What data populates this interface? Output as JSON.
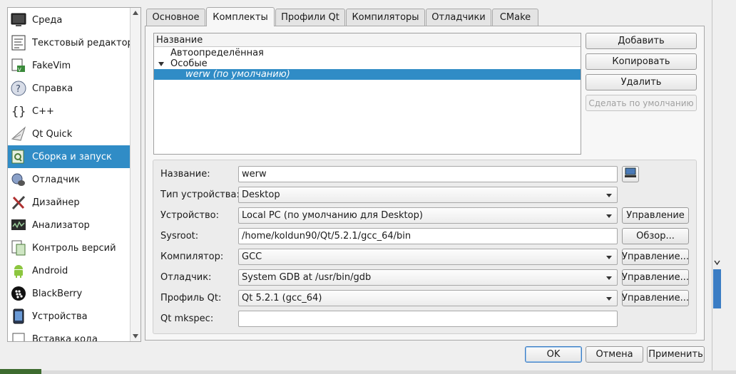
{
  "sidebar": {
    "items": [
      {
        "label": "Среда",
        "icon": "monitor-icon",
        "selected": false
      },
      {
        "label": "Текстовый редактор",
        "icon": "text-editor-icon",
        "selected": false
      },
      {
        "label": "FakeVim",
        "icon": "fakevim-icon",
        "selected": false
      },
      {
        "label": "Справка",
        "icon": "help-icon",
        "selected": false
      },
      {
        "label": "C++",
        "icon": "braces-icon",
        "selected": false
      },
      {
        "label": "Qt Quick",
        "icon": "qtquick-icon",
        "selected": false
      },
      {
        "label": "Сборка и запуск",
        "icon": "build-run-icon",
        "selected": true
      },
      {
        "label": "Отладчик",
        "icon": "debugger-icon",
        "selected": false
      },
      {
        "label": "Дизайнер",
        "icon": "designer-icon",
        "selected": false
      },
      {
        "label": "Анализатор",
        "icon": "analyzer-icon",
        "selected": false
      },
      {
        "label": "Контроль версий",
        "icon": "version-control-icon",
        "selected": false
      },
      {
        "label": "Android",
        "icon": "android-icon",
        "selected": false
      },
      {
        "label": "BlackBerry",
        "icon": "blackberry-icon",
        "selected": false
      },
      {
        "label": "Устройства",
        "icon": "devices-icon",
        "selected": false
      },
      {
        "label": "Вставка кода",
        "icon": "code-paste-icon",
        "selected": false
      }
    ]
  },
  "tabs": [
    {
      "label": "Основное",
      "active": false
    },
    {
      "label": "Комплекты",
      "active": true
    },
    {
      "label": "Профили Qt",
      "active": false
    },
    {
      "label": "Компиляторы",
      "active": false
    },
    {
      "label": "Отладчики",
      "active": false
    },
    {
      "label": "CMake",
      "active": false
    }
  ],
  "kits": {
    "header": "Название",
    "auto_group": "Автоопределённая",
    "manual_group": "Особые",
    "selected_kit": "werw (по умолчанию)"
  },
  "kit_buttons": {
    "add": "Добавить",
    "copy": "Копировать",
    "remove": "Удалить",
    "make_default": "Сделать по умолчанию"
  },
  "form": {
    "name_label": "Название:",
    "name_value": "werw",
    "device_type_label": "Тип устройства:",
    "device_type_value": "Desktop",
    "device_label": "Устройство:",
    "device_value": "Local PC (по умолчанию для Desktop)",
    "device_manage": "Управление",
    "sysroot_label": "Sysroot:",
    "sysroot_value": "/home/koldun90/Qt/5.2.1/gcc_64/bin",
    "sysroot_browse": "Обзор...",
    "compiler_label": "Компилятор:",
    "compiler_value": "GCC",
    "compiler_manage": "Управление...",
    "debugger_label": "Отладчик:",
    "debugger_value": "System GDB at /usr/bin/gdb",
    "debugger_manage": "Управление...",
    "qt_label": "Профиль Qt:",
    "qt_value": "Qt 5.2.1 (gcc_64)",
    "qt_manage": "Управление...",
    "mkspec_label": "Qt mkspec:",
    "mkspec_value": ""
  },
  "dialog_buttons": {
    "ok": "OK",
    "cancel": "Отмена",
    "apply": "Применить"
  },
  "colors": {
    "selection": "#308cc6",
    "default_button_border": "#3b7dc4"
  }
}
